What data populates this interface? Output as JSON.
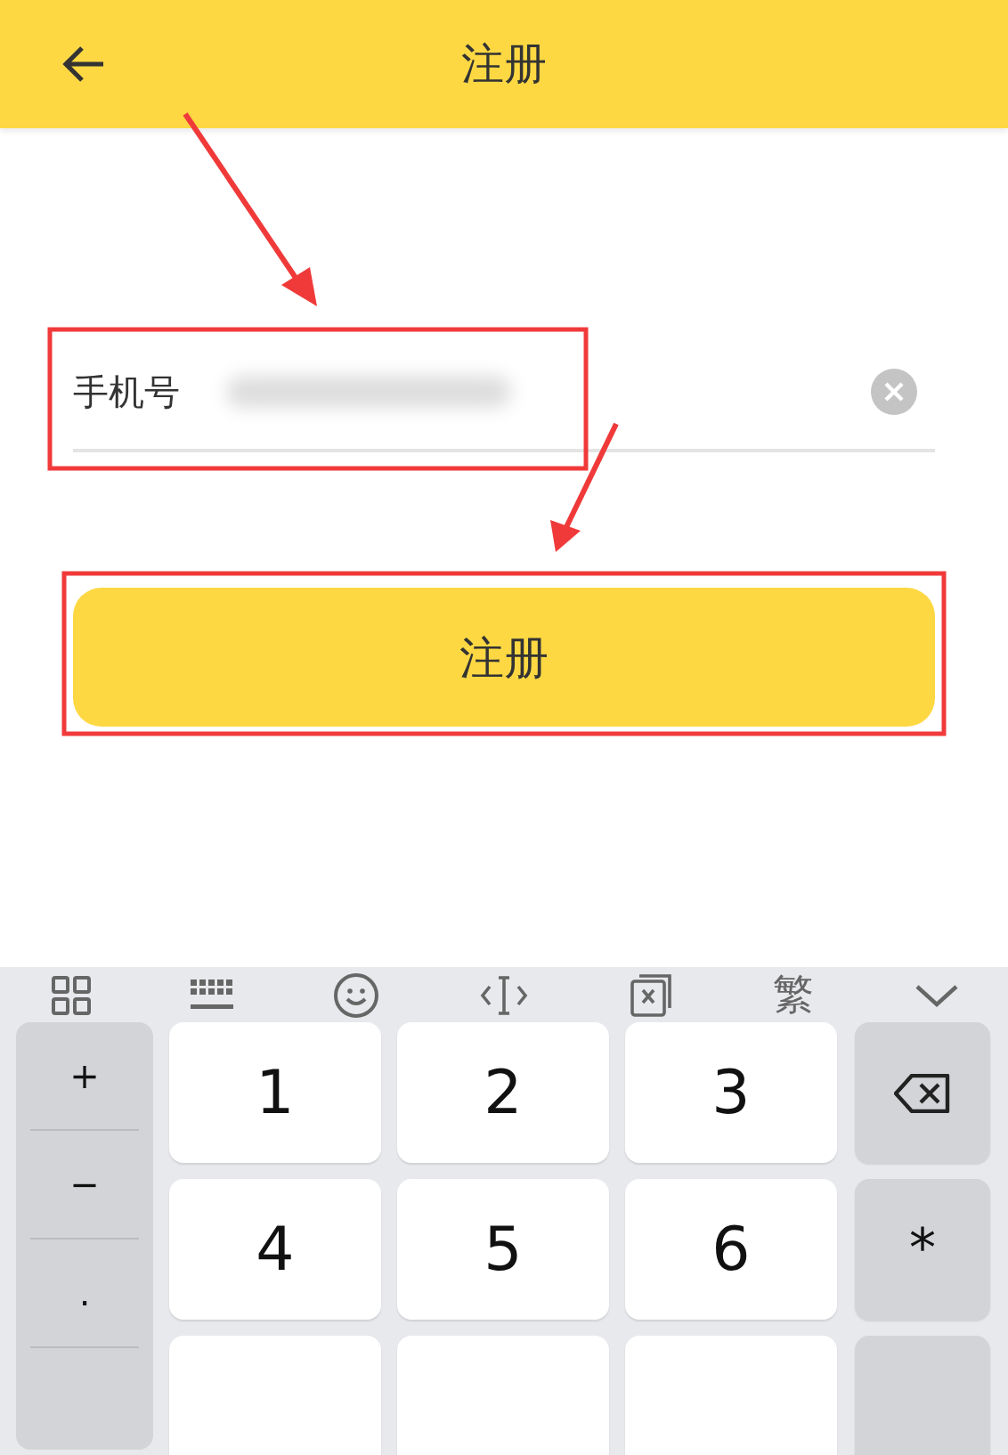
{
  "header": {
    "title": "注册"
  },
  "form": {
    "label": "手机号",
    "value_redacted": true,
    "clear": true
  },
  "button": {
    "label": "注册"
  },
  "keyboard": {
    "toolbar": [
      {
        "kind": "grid"
      },
      {
        "kind": "keyboard"
      },
      {
        "kind": "emoji"
      },
      {
        "kind": "cursor"
      },
      {
        "kind": "clipboard"
      },
      {
        "kind": "text",
        "label": "繁"
      },
      {
        "kind": "collapse"
      }
    ],
    "side_keys": [
      "+",
      "−",
      "."
    ],
    "keys": [
      {
        "kind": "digit",
        "label": "1"
      },
      {
        "kind": "digit",
        "label": "2"
      },
      {
        "kind": "digit",
        "label": "3"
      },
      {
        "kind": "backspace"
      },
      {
        "kind": "digit",
        "label": "4"
      },
      {
        "kind": "digit",
        "label": "5"
      },
      {
        "kind": "digit",
        "label": "6"
      },
      {
        "kind": "symbol",
        "label": "*"
      },
      {
        "kind": "blank"
      },
      {
        "kind": "blank"
      },
      {
        "kind": "blank"
      },
      {
        "kind": "blank-side"
      }
    ]
  }
}
